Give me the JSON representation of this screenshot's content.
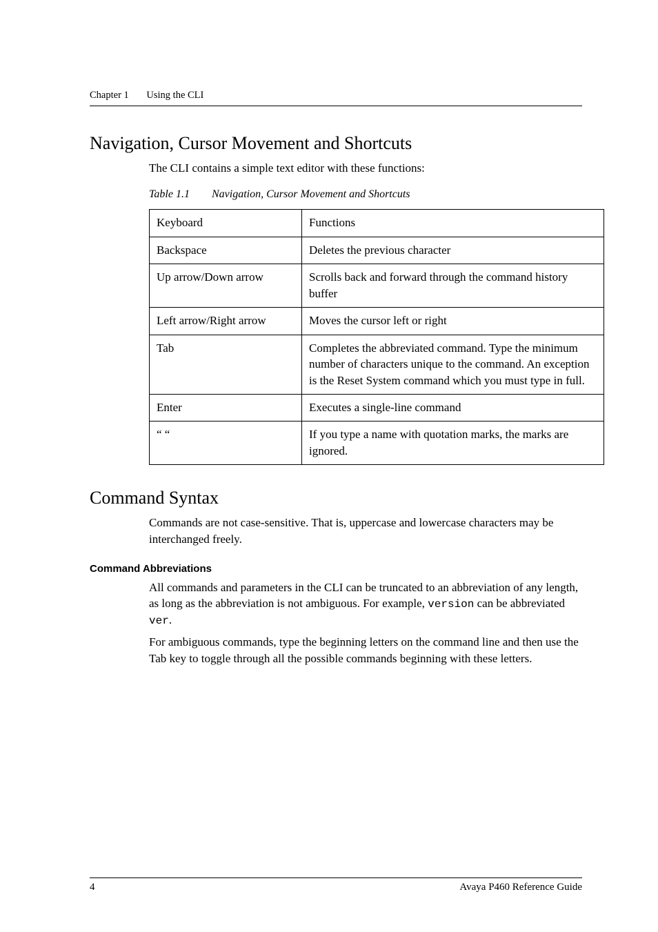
{
  "header": {
    "chapter_label": "Chapter 1",
    "chapter_title": "Using the CLI"
  },
  "sections": {
    "nav_heading": "Navigation, Cursor Movement and Shortcuts",
    "nav_intro": "The CLI contains a simple text editor with these functions:",
    "table_caption_num": "Table 1.1",
    "table_caption_title": "Navigation, Cursor Movement and Shortcuts",
    "table_header_key": "Keyboard",
    "table_header_func": "Functions",
    "rows": [
      {
        "key": "Backspace",
        "func": "Deletes the previous character"
      },
      {
        "key": "Up arrow/Down arrow",
        "func": "Scrolls back and forward through the command history buffer"
      },
      {
        "key": "Left arrow/Right arrow",
        "func": "Moves the cursor left or right"
      },
      {
        "key": "Tab",
        "func": "Completes the abbreviated command. Type the minimum number of characters unique to the command. An exception is the Reset System command which you must type in full."
      },
      {
        "key": "Enter",
        "func": "Executes a single-line command"
      },
      {
        "key": "“ “",
        "func": "If you type a name with quotation marks, the marks are ignored."
      }
    ],
    "syntax_heading": "Command Syntax",
    "syntax_intro": "Commands are not case-sensitive. That is, uppercase and lowercase characters may be interchanged freely.",
    "abbrev_heading": "Command Abbreviations",
    "abbrev_p1_a": "All commands and parameters in the CLI can be truncated to an abbreviation of any length, as long as the abbreviation is not ambiguous. For example, ",
    "abbrev_p1_code1": "version",
    "abbrev_p1_b": " can be abbreviated ",
    "abbrev_p1_code2": "ver",
    "abbrev_p1_c": ".",
    "abbrev_p2": "For ambiguous commands, type the beginning letters on the command line and then use the Tab key to toggle through all the possible commands beginning with these letters."
  },
  "footer": {
    "page_number": "4",
    "guide_title": "Avaya P460 Reference Guide"
  }
}
